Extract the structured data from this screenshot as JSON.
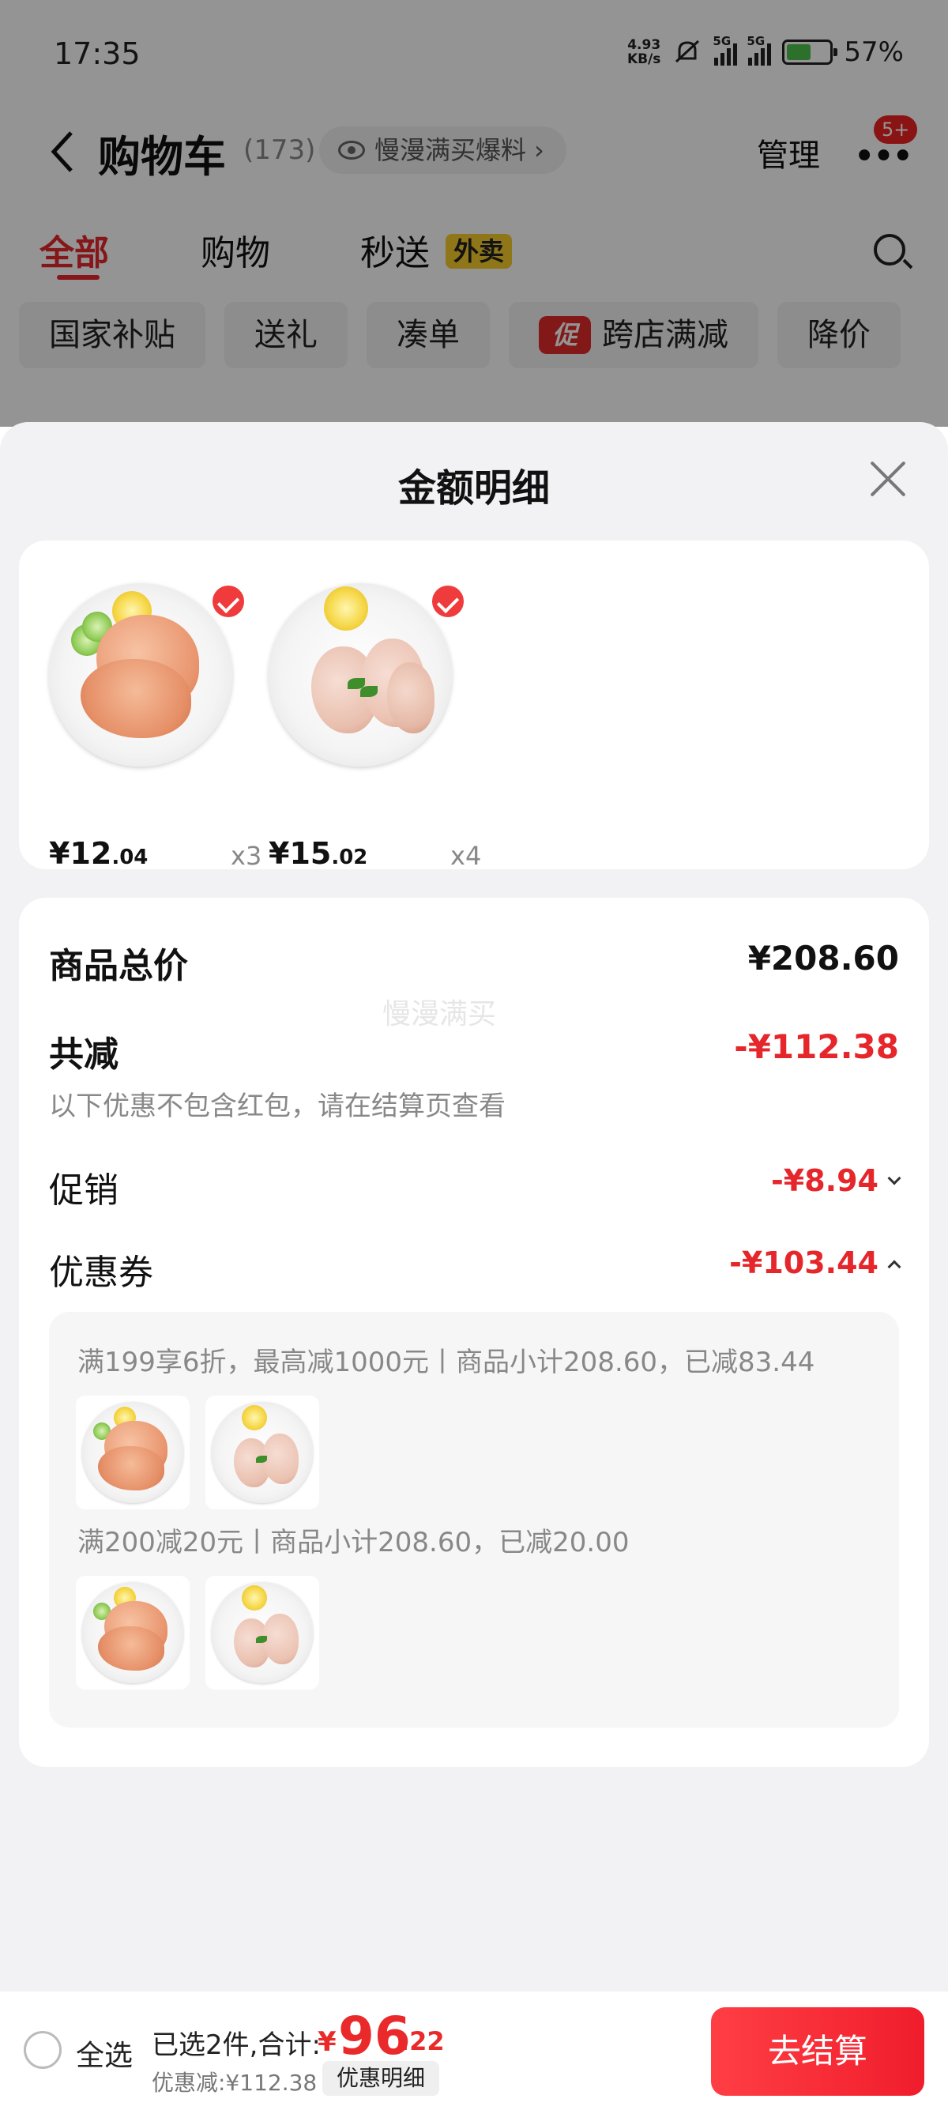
{
  "status": {
    "time": "17:35",
    "net_speed_value": "4.93",
    "net_speed_unit": "KB/s",
    "signal1": "5G",
    "signal2": "5G",
    "battery": "57%"
  },
  "nav": {
    "title": "购物车",
    "count": "(173)",
    "chip_text": "慢漫满买爆料 ›",
    "manage": "管理",
    "more": "•••",
    "badge": "5+"
  },
  "tabs": [
    {
      "label": "全部"
    },
    {
      "label": "购物"
    },
    {
      "label": "秒送"
    }
  ],
  "tab_tag": "外卖",
  "filter_chips": [
    "国家补贴",
    "送礼",
    "凑单",
    "跨店满减",
    "降价"
  ],
  "promo_icon": "促",
  "sheet": {
    "title": "金额明细",
    "products": [
      {
        "price_int": "¥12",
        "price_dec": ".04",
        "qty": "x3"
      },
      {
        "price_int": "¥15",
        "price_dec": ".02",
        "qty": "x4"
      }
    ],
    "watermark": "慢漫满买",
    "total_label": "商品总价",
    "total_value": "¥208.60",
    "reduce_label": "共减",
    "reduce_value": "-¥112.38",
    "reduce_note": "以下优惠不包含红包，请在结算页查看",
    "promo_label": "促销",
    "promo_value": "-¥8.94",
    "coupon_label": "优惠券",
    "coupon_value": "-¥103.44",
    "coupon_rules": [
      "满199享6折，最高减1000元丨商品小计208.60，已减83.44",
      "满200减20元丨商品小计208.60，已减20.00"
    ]
  },
  "bottom": {
    "select_all": "全选",
    "selected_info": "已选2件,合计:",
    "currency": "¥",
    "total_int": "96",
    "total_dec": ".22",
    "discount": "优惠减:¥112.38",
    "detail_button": "优惠明细",
    "checkout": "去结算"
  },
  "colors": {
    "accent_red": "#e5262b",
    "checkout_red": "#f01d2c",
    "tag_yellow": "#f5cc2b"
  }
}
